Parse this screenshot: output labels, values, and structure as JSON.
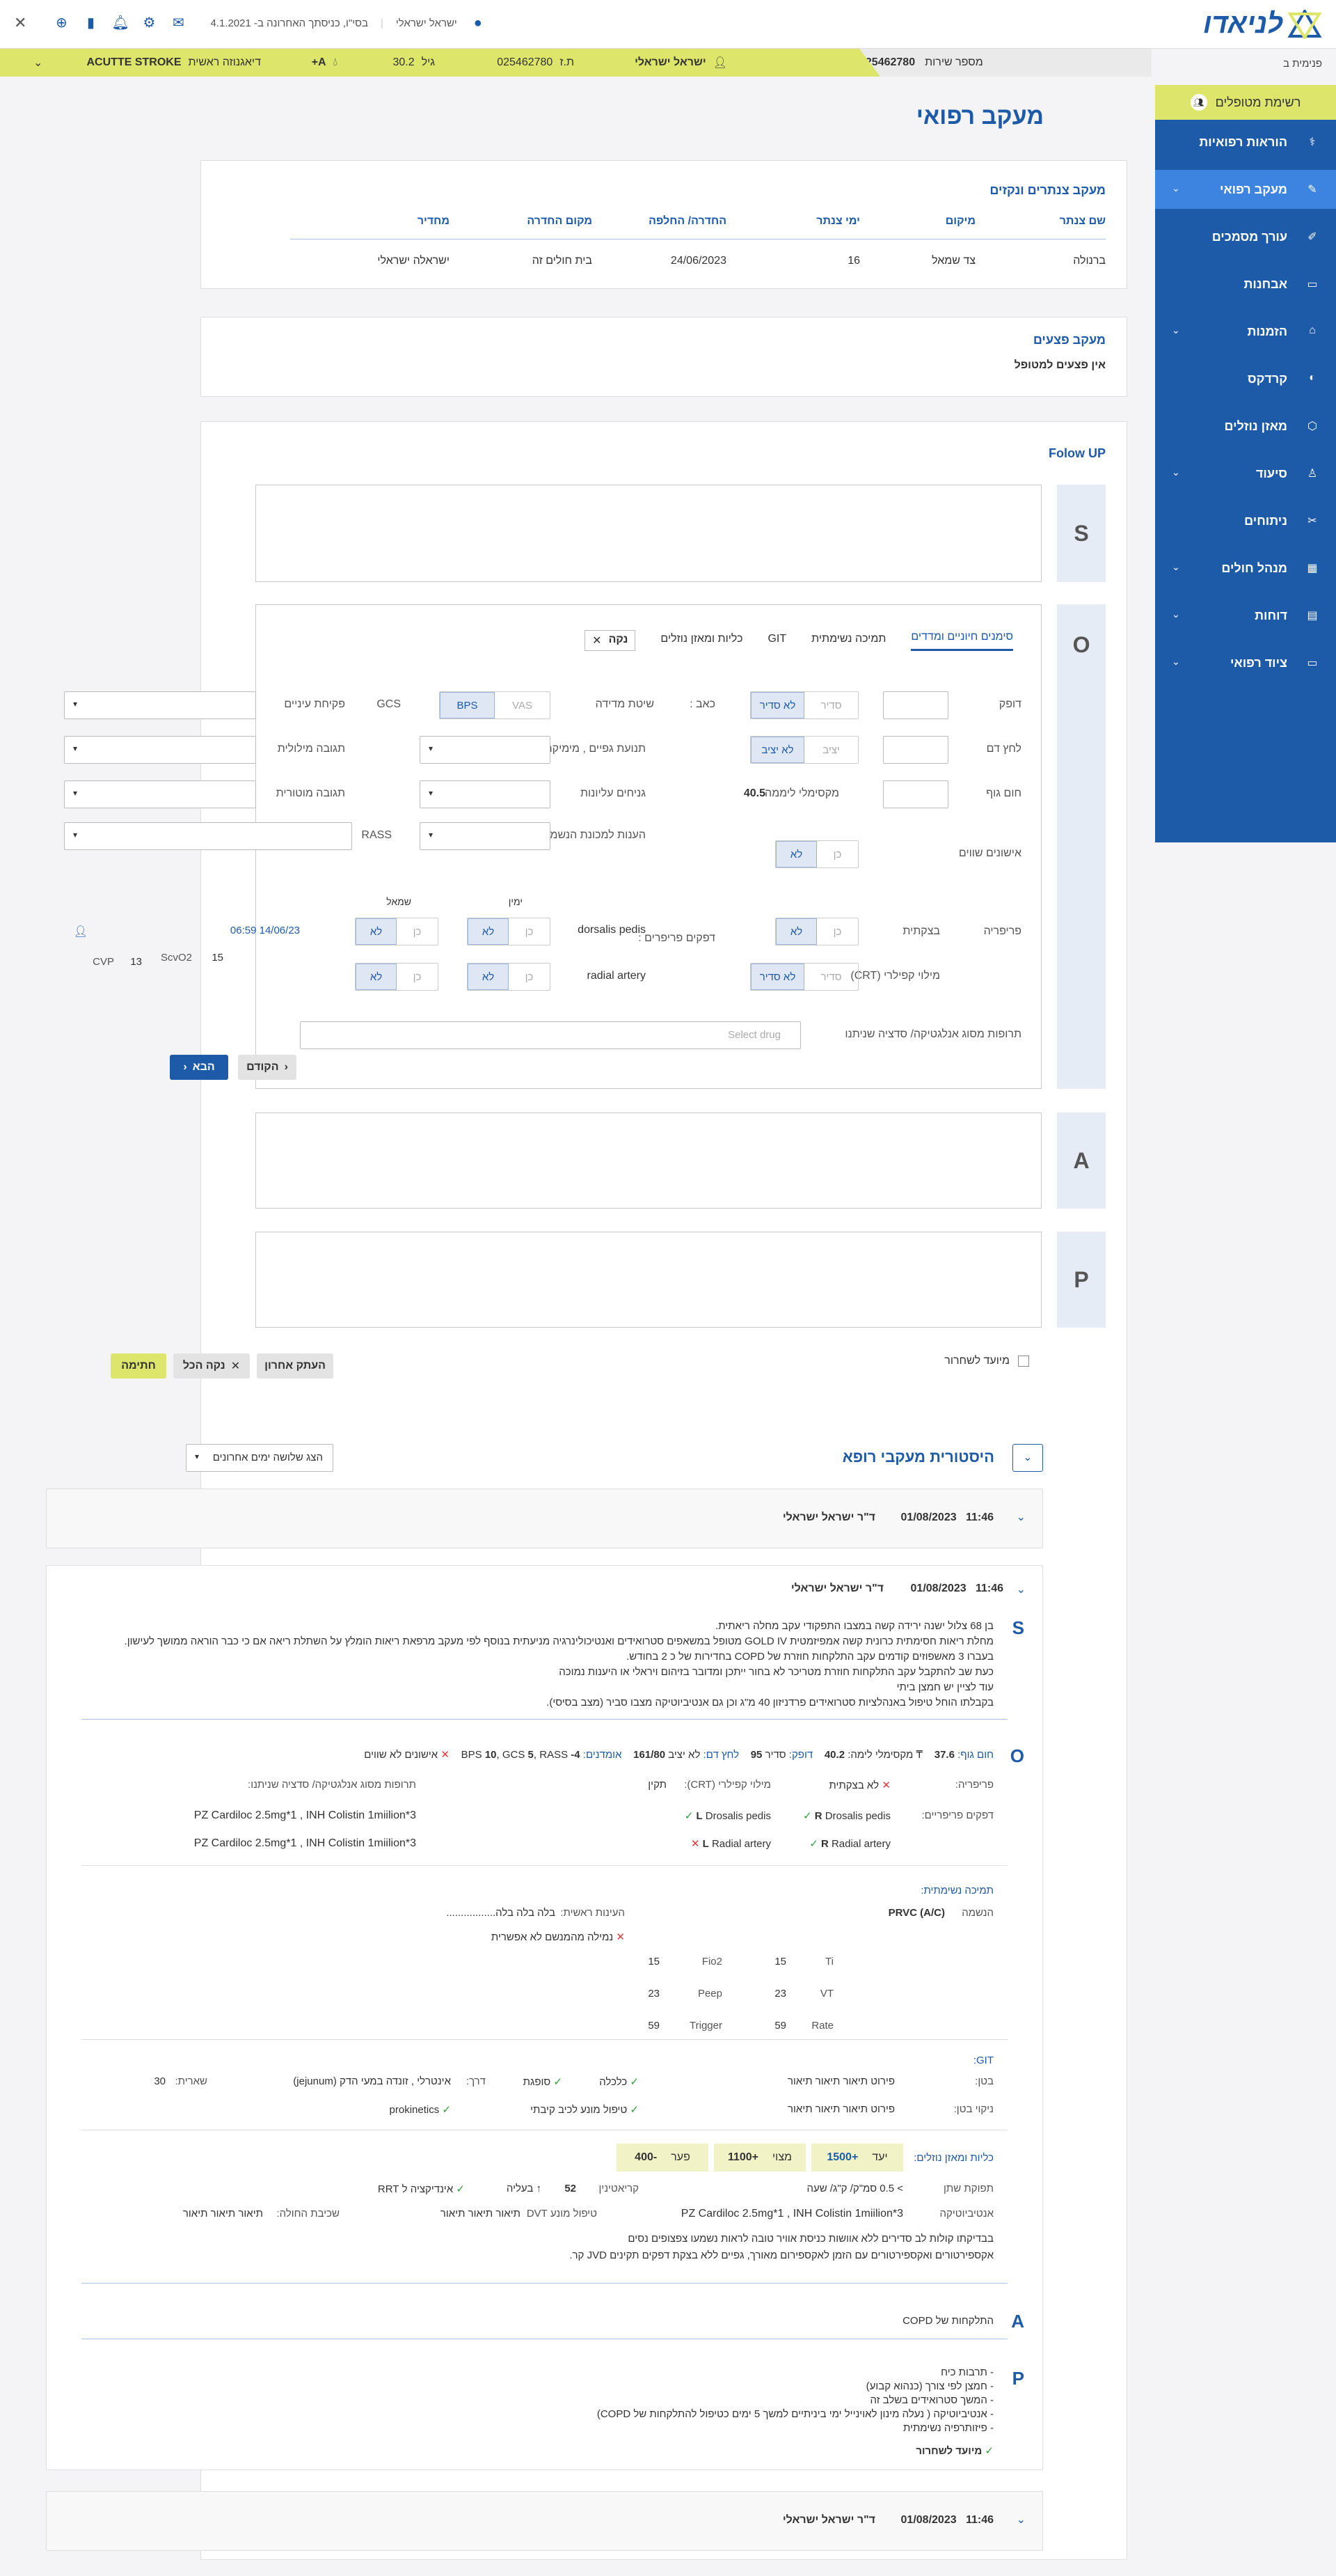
{
  "header": {
    "logo": "לניאדו",
    "user": "ישראל ישראלי",
    "system": "בסי\"ו, כניסתך האחרונה ב- 4.1.2021",
    "crumb": "פנימית ב"
  },
  "patient": {
    "service_label": "מספר שירות",
    "service_no": "025462780",
    "name": "ישראל ישראלי",
    "id_label": "ת.ז",
    "id": "025462780",
    "age_label": "גיל",
    "age": "30.2",
    "blood": "A+",
    "dx_label": "דיאגנוזה ראשית",
    "dx": "ACUTTE STROKE"
  },
  "sidebar": {
    "top": "רשימת מטופלים",
    "items": [
      "הוראות רפואיות",
      "מעקב רפואי",
      "עורך מסמכים",
      "אבחנות",
      "הזמנות",
      "קרדקס",
      "מאזן נוזלים",
      "סיעוד",
      "ניתוחים",
      "מנהל חולים",
      "דוחות",
      "ציוד רפואי"
    ]
  },
  "page": {
    "title": "מעקב רפואי"
  },
  "catheters": {
    "title": "מעקב צנתרים ונקזים",
    "headers": [
      "שם צנתר",
      "מיקום",
      "ימי צנתר",
      "החדרה/ החלפה",
      "מקום החדרה",
      "מחדיר"
    ],
    "row": [
      "ברנולה",
      "צד שמאל",
      "16",
      "24/06/2023",
      "בית חולים זה",
      "ישראלה ישראלי"
    ]
  },
  "wounds": {
    "title": "מעקב פצעים",
    "text": "אין פצעים למטופל"
  },
  "followup": {
    "title": "Folow UP",
    "letters": [
      "S",
      "O",
      "A",
      "P"
    ]
  },
  "otabs": {
    "tabs": [
      "סימנים חיוניים ומדדים",
      "תמיכה נשימתית",
      "GIT",
      "כליות ומאזן נוזלים"
    ],
    "clear": "נקה"
  },
  "vitals": {
    "pulse": "דופק",
    "bp": "לחץ דם",
    "temp": "חום גוף",
    "maxtemp": "מקסימלי ליממה",
    "maxtemp_val": "40.5",
    "pain": "כאב :",
    "method": "שיטת מדידה",
    "vas": "VAS",
    "bps": "BPS",
    "eyes": "פקיחת עיניים",
    "gcs": "GCS",
    "limbs": "תנועת גפיים , מימיקה",
    "verbal": "תגובה מילולית",
    "upper": "גניחים עליונות",
    "motor": "תגובה מוטורית",
    "vent": "הענות למכונת הנשמה",
    "rass": "RASS",
    "pupils": "אישונים שווים",
    "regular": "סדיר",
    "notregular": "לא סדיר",
    "stable": "יציב",
    "notstable": "לא יציב",
    "yes": "כן",
    "no": "לא"
  },
  "periph": {
    "label": "פריפריה",
    "cold": "בצקתית",
    "pulses": "דפקים פריפרים :",
    "dorsalis": "dorsalis pedis",
    "radial": "radial artery",
    "crt": "מילוי קפילרי (CRT)",
    "right": "ימין",
    "left": "שמאל",
    "date": "14/06/23 06:59",
    "cvp": "CVP",
    "cvp_v": "13",
    "scvo2": "ScvO2",
    "scvo2_v": "15",
    "drug_label": "תרופות מסוג אנלגטיקה/ סדציה שניתנו",
    "drug_ph": "Select drug",
    "next": "הבא",
    "prev": "הקודם"
  },
  "actions": {
    "discharge": "מיועד לשחרור",
    "copy": "העתק אחרון",
    "clearall": "נקה הכל",
    "sign": "חתימה"
  },
  "history": {
    "title": "היסטורית מעקבי רופא",
    "filter": "הצג שלושה ימים אחרונים",
    "date": "01/08/2023",
    "time": "11:46",
    "doctor": "ד\"ר ישראל ישראלי",
    "s_lines": [
      "בן 68 צלול ישנה ירידה קשה במצבו התפקודי עקב מחלה ריאתית.",
      "מחלת ריאות חסימתית כרונית קשה אמפיזמטית GOLD IV מטופל במשאפים סטרואידים ואנטיכולינרגיה מניעתית בנוסף לפי מעקב מרפאת ריאות הומלץ על השתלת ריאה אם כי כבר הוראה ממושך לעישון.",
      "בעברו 3 מאשפוזים קודמים עקב התלקחות חוזרת של COPD בחדירות של כ 2 בחודש.",
      "כעת שב להתקבל עקב התלקחות חוזרת מטריכר לא בחור ייתכן ומדובר בזיהום ויראלי או היענות נמוכה",
      "עוד לציין יש חמצן ביתי",
      "בקבלתו הוחל טיפול באנהלציות סטרואידים פרדניזון 40 מ\"ג וכן גם אנטיביוטיקה מצבו סביר (מצב בסיסי)."
    ],
    "o": {
      "temp_l": "חום גוף:",
      "temp": "37.6",
      "maxtemp_l": "מקסימלי לימה:",
      "maxtemp": "40.2",
      "pulse_l": "דופק:",
      "pulse": "95",
      "pulse_s": "סדיר",
      "bp_l": "לחץ דם:",
      "bp_s": "לא יציב",
      "bp": "161/80",
      "ind_l": "אומדנים:",
      "bps": "BPS",
      "bps_v": "10",
      "gcs": "GCS",
      "gcs_v": "5",
      "rass": "RASS",
      "rass_v": "-4",
      "pupils": "אישונים לא שווים",
      "periph_l": "פריפריה:",
      "periph": "לא בצקתית",
      "crt_l": "מילוי קפילרי (CRT):",
      "crt": "תקין",
      "drugs_l": "תרופות מסוג אנלגטיקה/ סדציה שניתנו:",
      "pulses_l": "דפקים פריפריים:",
      "drosalis_r": "Drosalis pedis",
      "drosalis_l": "Drosalis pedis",
      "radial_r": "Radial artery",
      "radial_l": "Radial artery",
      "R": "R",
      "L": "L",
      "drug1": "PZ Cardiloc 2.5mg*1 ,  INH Colistin 1miilion*3",
      "drug2": "PZ Cardiloc 2.5mg*1 ,  INH Colistin 1miilion*3"
    },
    "resp": {
      "title": "תמיכה נשימתית:",
      "vent_l": "הנשמה",
      "vent": "(A/C) PRVC",
      "prime_l": "העינות ראשית:",
      "prime": "בלה בלה בלה.................",
      "noext": "נמילה מהמנשם לא אפשרית",
      "ti": "Ti",
      "ti_v": "15",
      "fio2": "Fio2",
      "fio2_v": "15",
      "vt": "VT",
      "vt_v": "23",
      "peep": "Peep",
      "peep_v": "23",
      "rate": "Rate",
      "rate_v": "59",
      "trig": "Trigger",
      "trig_v": "59"
    },
    "git": {
      "title": "GIT:",
      "belly_l": "בטן:",
      "belly": "פירוט תיאור תיאור תיאור",
      "clean_l": "ניקוי בטן:",
      "clean": "פירוט תיאור תיאור תיאור",
      "c1": "כלכלה",
      "c2": "סופגת",
      "route_l": "דרך:",
      "route": "אינטרלי , זונדה במעי הדק (jejunum)",
      "rem_l": "שארית:",
      "rem": "30",
      "c3": "טיפול מונע לכיב קיבתי",
      "c4": "prokinetics"
    },
    "kid": {
      "title": "כליות ומאזן נוזלים:",
      "target_l": "יעד",
      "target": "+1500",
      "actual_l": "מצוי",
      "actual": "+1100",
      "gap_l": "פער",
      "gap": "-400",
      "urine_l": "תפוקת שתן",
      "urine": "> 0.5 סמ\"ק/ ק\"ג/ שעה",
      "creat_l": "קריאטינין",
      "creat": "52",
      "rise": "בעליה",
      "rrt": "אינדיקציה ל RRT",
      "abx_l": "אנטיביוטיקה",
      "abx": "PZ Cardiloc 2.5mg*1 ,  INH Colistin 1miilion*3",
      "dvt_l": "טיפול מונע DVT",
      "dvt": "תיאור תיאור תיאור",
      "fall_l": "שכיבת החולה:",
      "fall": "תיאור תיאור תיאור",
      "note1": "בבדיקתו קולות לב סדירים ללא אוושות כניסת אוויר טובה לראות נשמעו צפצופים נסים",
      "note2": "אקספירטורים ואקספירטורים עם הזמן לאקספירום מאורך, גפיים ללא בצקת דפקים תקינים JVD קר."
    },
    "a": "התלקחות של COPD",
    "p_lines": [
      "- תרבות כיח",
      "- חמצן לפי צורך (כנהוא קבוע)",
      "- המשך סטרואידים בשלב זה",
      "- אנטיביוטיקה ( נעלה מינון לאוינייל ימי ביניתיים למשך 5 ימים כטיפול להתלקחות של COPD)",
      "- פיזותרפיה נשימתית"
    ],
    "discharge": "מיועד לשחרור"
  }
}
